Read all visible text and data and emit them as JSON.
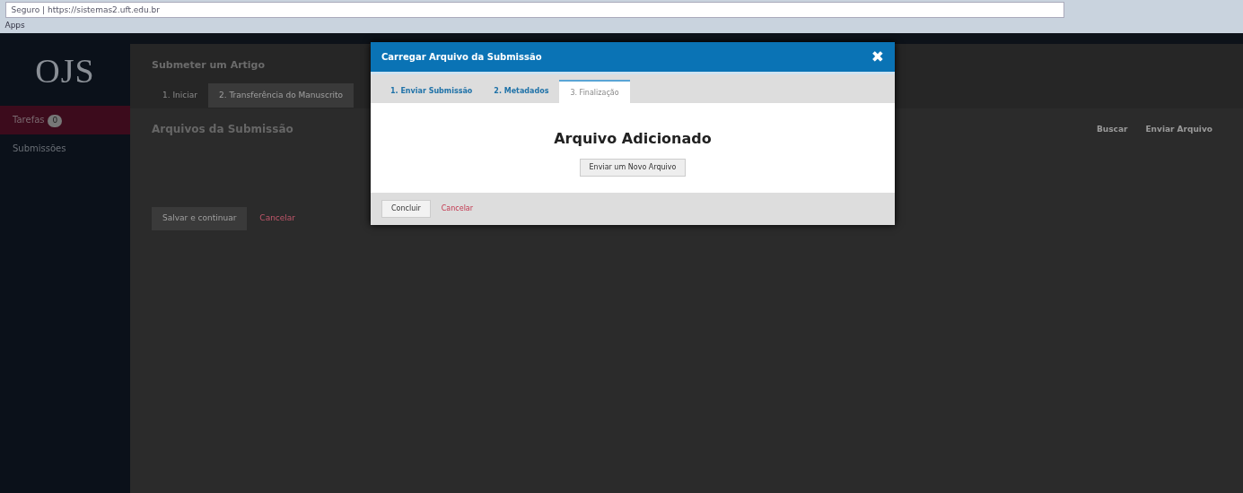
{
  "browser": {
    "address": "Seguro | https://sistemas2.uft.edu.br",
    "bookmarks": [
      "Apps"
    ]
  },
  "sidebar": {
    "logo": "OJS",
    "items": [
      {
        "label": "Tarefas",
        "badge": "0",
        "selected": true
      },
      {
        "label": "Submissões",
        "selected": false
      }
    ]
  },
  "page": {
    "title": "Submeter um Artigo",
    "steps": [
      {
        "label": "1. Iniciar",
        "selected": false
      },
      {
        "label": "2. Transferência do Manuscrito",
        "selected": true
      }
    ],
    "files_title": "Arquivos da Submissão",
    "actions": [
      "Buscar",
      "Enviar Arquivo"
    ],
    "save_button": "Salvar e continuar",
    "cancel_link": "Cancelar"
  },
  "modal": {
    "title": "Carregar Arquivo da Submissão",
    "close": "✖",
    "tabs": [
      {
        "label": "1. Enviar Submissão",
        "selected": false
      },
      {
        "label": "2. Metadados",
        "selected": false
      },
      {
        "label": "3. Finalização",
        "selected": true
      }
    ],
    "heading": "Arquivo Adicionado",
    "upload_button": "Enviar um Novo Arquivo",
    "complete_button": "Concluir",
    "cancel_link": "Cancelar"
  }
}
